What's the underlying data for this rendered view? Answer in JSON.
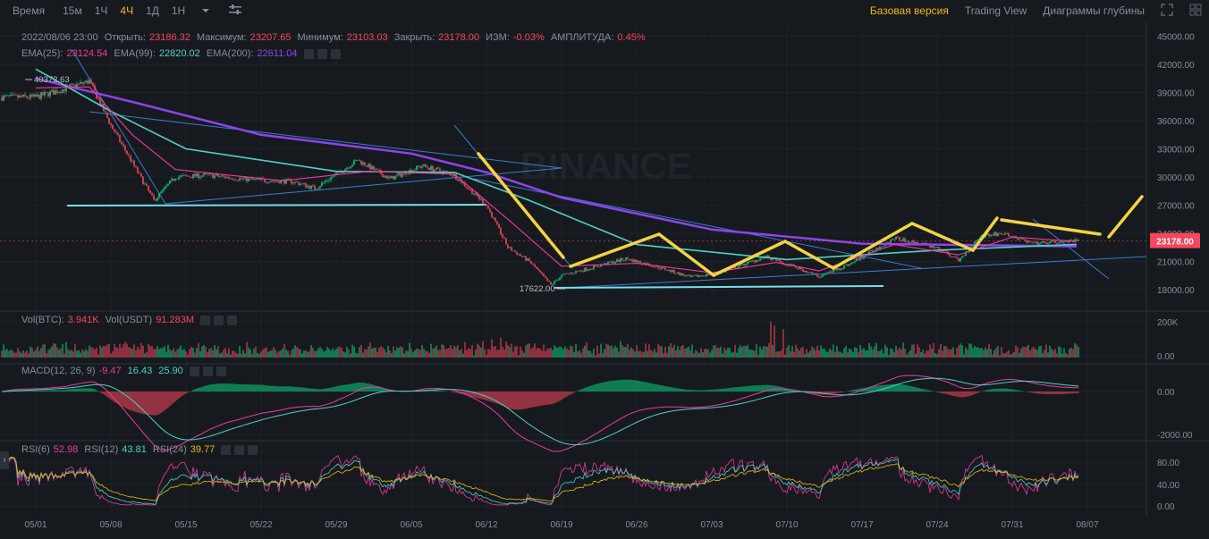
{
  "toolbar": {
    "time_label": "Время",
    "intervals": [
      "15м",
      "1Ч",
      "4Ч",
      "1Д",
      "1Н"
    ],
    "active_interval": "4Ч",
    "views": [
      "Базовая версия",
      "Trading View",
      "Диаграммы глубины"
    ],
    "active_view": "Базовая версия"
  },
  "ohlc": {
    "date": "2022/08/06 23:00",
    "open_label": "Открыть:",
    "open": "23186.32",
    "high_label": "Максимум:",
    "high": "23207.65",
    "low_label": "Минимум:",
    "low": "23103.03",
    "close_label": "Закрыть:",
    "close": "23178.00",
    "change_label": "ИЗМ:",
    "change": "-0.03%",
    "amp_label": "АМПЛИТУДА:",
    "amp": "0.45%"
  },
  "ema": {
    "ema25_label": "EMA(25):",
    "ema25": "23124.54",
    "ema99_label": "EMA(99):",
    "ema99": "22820.02",
    "ema200_label": "EMA(200):",
    "ema200": "22611.04"
  },
  "vol": {
    "btc_label": "Vol(BTC):",
    "btc": "3.941K",
    "usdt_label": "Vol(USDT)",
    "usdt": "91.283M"
  },
  "macd": {
    "label": "MACD(12, 26, 9)",
    "macd": "-9.47",
    "signal": "16.43",
    "hist": "25.90"
  },
  "rsi": {
    "rsi6_label": "RSI(6)",
    "rsi6": "52.98",
    "rsi12_label": "RSI(12)",
    "rsi12": "43.81",
    "rsi24_label": "RSI(24)",
    "rsi24": "39.77"
  },
  "watermark": "BINANCE",
  "colors": {
    "up": "#0ecb81",
    "down": "#f6465d",
    "accent": "#f0b90b",
    "ema25": "#f038a0",
    "ema99": "#4fd1c5",
    "ema200": "#8e44ec",
    "annotation": "#f5d342",
    "trendline": "#3a7bd5",
    "support": "#74e0f0"
  },
  "chart_data": {
    "type": "candlestick",
    "symbol_interval": "4Ч",
    "x_ticks": [
      "05/01",
      "05/08",
      "05/15",
      "05/22",
      "05/29",
      "06/05",
      "06/12",
      "06/19",
      "06/26",
      "07/03",
      "07/10",
      "07/17",
      "07/24",
      "07/31",
      "08/07"
    ],
    "price_axis": {
      "ticks": [
        "45000.00",
        "42000.00",
        "39000.00",
        "36000.00",
        "33000.00",
        "30000.00",
        "27000.00",
        "24000.00",
        "21000.00",
        "18000.00"
      ],
      "ylim": [
        16000,
        46000
      ]
    },
    "last_price": "23178.00",
    "marked_high": "40372.63",
    "marked_low": "17622.00",
    "price_path": [
      {
        "x": "05/01",
        "y": 38500
      },
      {
        "x": "05/04",
        "y": 39500
      },
      {
        "x": "05/06",
        "y": 40200
      },
      {
        "x": "05/08",
        "y": 35500
      },
      {
        "x": "05/10",
        "y": 31500
      },
      {
        "x": "05/12",
        "y": 27500
      },
      {
        "x": "05/14",
        "y": 30000
      },
      {
        "x": "05/17",
        "y": 30200
      },
      {
        "x": "05/21",
        "y": 29700
      },
      {
        "x": "05/25",
        "y": 29500
      },
      {
        "x": "05/27",
        "y": 28800
      },
      {
        "x": "05/31",
        "y": 31800
      },
      {
        "x": "06/03",
        "y": 29800
      },
      {
        "x": "06/06",
        "y": 31200
      },
      {
        "x": "06/09",
        "y": 30200
      },
      {
        "x": "06/12",
        "y": 27000
      },
      {
        "x": "06/14",
        "y": 22500
      },
      {
        "x": "06/16",
        "y": 21000
      },
      {
        "x": "06/18",
        "y": 18500
      },
      {
        "x": "06/19",
        "y": 19500
      },
      {
        "x": "06/22",
        "y": 20400
      },
      {
        "x": "06/25",
        "y": 21300
      },
      {
        "x": "06/28",
        "y": 20400
      },
      {
        "x": "07/01",
        "y": 19300
      },
      {
        "x": "07/04",
        "y": 19900
      },
      {
        "x": "07/08",
        "y": 21500
      },
      {
        "x": "07/11",
        "y": 20300
      },
      {
        "x": "07/13",
        "y": 19400
      },
      {
        "x": "07/16",
        "y": 20800
      },
      {
        "x": "07/20",
        "y": 23500
      },
      {
        "x": "07/24",
        "y": 22500
      },
      {
        "x": "07/26",
        "y": 21100
      },
      {
        "x": "07/28",
        "y": 23700
      },
      {
        "x": "07/30",
        "y": 24000
      },
      {
        "x": "08/02",
        "y": 22900
      },
      {
        "x": "08/06",
        "y": 23178
      }
    ],
    "ema25": [
      {
        "x": "05/01",
        "y": 39500
      },
      {
        "x": "05/06",
        "y": 39600
      },
      {
        "x": "05/10",
        "y": 34500
      },
      {
        "x": "05/14",
        "y": 30800
      },
      {
        "x": "05/24",
        "y": 29600
      },
      {
        "x": "06/01",
        "y": 30600
      },
      {
        "x": "06/09",
        "y": 30300
      },
      {
        "x": "06/14",
        "y": 25500
      },
      {
        "x": "06/19",
        "y": 20500
      },
      {
        "x": "06/26",
        "y": 20800
      },
      {
        "x": "07/03",
        "y": 19800
      },
      {
        "x": "07/09",
        "y": 20900
      },
      {
        "x": "07/13",
        "y": 20000
      },
      {
        "x": "07/20",
        "y": 22800
      },
      {
        "x": "07/26",
        "y": 21700
      },
      {
        "x": "07/31",
        "y": 23600
      },
      {
        "x": "08/06",
        "y": 23124
      }
    ],
    "ema99": [
      {
        "x": "05/01",
        "y": 41500
      },
      {
        "x": "05/08",
        "y": 37000
      },
      {
        "x": "05/15",
        "y": 33000
      },
      {
        "x": "05/29",
        "y": 30600
      },
      {
        "x": "06/09",
        "y": 30500
      },
      {
        "x": "06/16",
        "y": 27500
      },
      {
        "x": "06/26",
        "y": 22800
      },
      {
        "x": "07/10",
        "y": 21200
      },
      {
        "x": "07/24",
        "y": 22200
      },
      {
        "x": "08/06",
        "y": 22820
      }
    ],
    "ema200": [
      {
        "x": "05/01",
        "y": 40500
      },
      {
        "x": "05/10",
        "y": 38000
      },
      {
        "x": "05/22",
        "y": 34500
      },
      {
        "x": "06/05",
        "y": 32500
      },
      {
        "x": "06/12",
        "y": 30500
      },
      {
        "x": "06/19",
        "y": 27800
      },
      {
        "x": "07/03",
        "y": 24400
      },
      {
        "x": "07/17",
        "y": 22900
      },
      {
        "x": "08/06",
        "y": 22611
      }
    ],
    "volume_axis": {
      "ticks": [
        "200K",
        "0.00"
      ]
    },
    "macd_axis": {
      "ticks": [
        "0.00",
        "-2000.00"
      ]
    },
    "rsi_axis": {
      "ticks": [
        "80.00",
        "40.00",
        "0.00"
      ]
    }
  }
}
